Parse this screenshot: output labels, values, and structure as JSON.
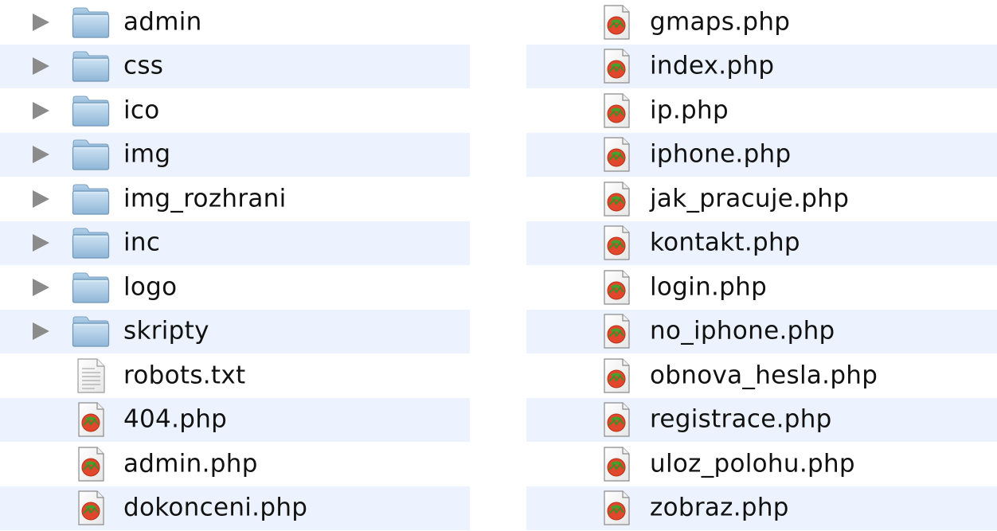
{
  "left_column": {
    "rows": [
      {
        "name": "admin",
        "type": "folder"
      },
      {
        "name": "css",
        "type": "folder"
      },
      {
        "name": "ico",
        "type": "folder"
      },
      {
        "name": "img",
        "type": "folder"
      },
      {
        "name": "img_rozhrani",
        "type": "folder"
      },
      {
        "name": "inc",
        "type": "folder"
      },
      {
        "name": "logo",
        "type": "folder"
      },
      {
        "name": "skripty",
        "type": "folder"
      },
      {
        "name": "robots.txt",
        "type": "text-file"
      },
      {
        "name": "404.php",
        "type": "php-file"
      },
      {
        "name": "admin.php",
        "type": "php-file"
      },
      {
        "name": "dokonceni.php",
        "type": "php-file"
      }
    ]
  },
  "right_column": {
    "rows": [
      {
        "name": "gmaps.php",
        "type": "php-file"
      },
      {
        "name": "index.php",
        "type": "php-file"
      },
      {
        "name": "ip.php",
        "type": "php-file"
      },
      {
        "name": "iphone.php",
        "type": "php-file"
      },
      {
        "name": "jak_pracuje.php",
        "type": "php-file"
      },
      {
        "name": "kontakt.php",
        "type": "php-file"
      },
      {
        "name": "login.php",
        "type": "php-file"
      },
      {
        "name": "no_iphone.php",
        "type": "php-file"
      },
      {
        "name": "obnova_hesla.php",
        "type": "php-file"
      },
      {
        "name": "registrace.php",
        "type": "php-file"
      },
      {
        "name": "uloz_polohu.php",
        "type": "php-file"
      },
      {
        "name": "zobraz.php",
        "type": "php-file"
      }
    ]
  },
  "icons": {
    "folder": "folder-icon",
    "text-file": "text-document-icon",
    "php-file": "php-file-icon",
    "disclosure": "disclosure-triangle-icon"
  },
  "colors": {
    "alt_row": "#edf3fe",
    "folder_blue": "#a9cbe6",
    "php_red": "#e2462c",
    "php_green": "#47a12d"
  }
}
